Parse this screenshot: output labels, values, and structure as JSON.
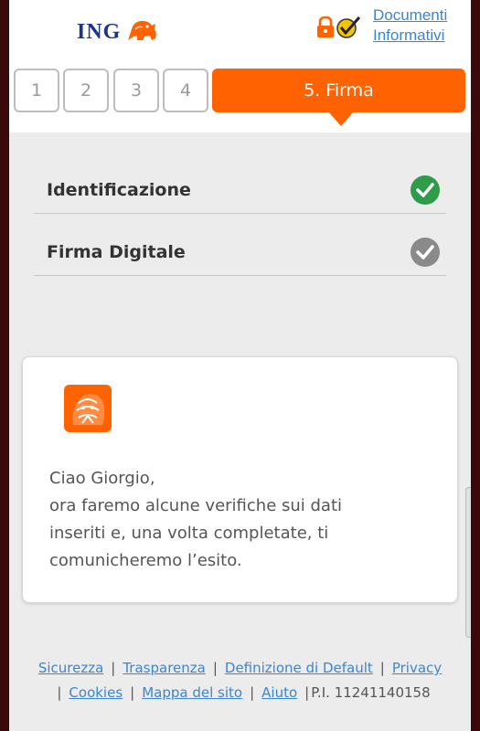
{
  "header": {
    "brand": "ING",
    "docs_link": "Documenti Informativi"
  },
  "steps": {
    "items": [
      "1",
      "2",
      "3",
      "4"
    ],
    "active_label": "5. Firma"
  },
  "checklist": [
    {
      "label": "Identificazione",
      "status": "completed"
    },
    {
      "label": "Firma Digitale",
      "status": "pending"
    }
  ],
  "message": {
    "greeting": "Ciao Giorgio,",
    "line1": "ora faremo alcune verifiche sui dati",
    "line2": "inseriti e, una volta completate, ti",
    "line3": "comunicheremo l’esito."
  },
  "footer": {
    "links": {
      "sicurezza": "Sicurezza",
      "trasparenza": "Trasparenza",
      "default": "Definizione di Default",
      "privacy": "Privacy",
      "cookies": "Cookies",
      "mappa": "Mappa del sito",
      "aiuto": "Aiuto"
    },
    "vat": "P.I. 11241140158"
  },
  "colors": {
    "accent": "#ff6200",
    "brand_blue": "#1d3586",
    "link": "#3a86d0",
    "success": "#2e9c4a",
    "pending": "#8a8a8a"
  },
  "icons": [
    "ing-lion-icon",
    "lock-icon",
    "shield-check-icon",
    "check-circle-icon"
  ]
}
